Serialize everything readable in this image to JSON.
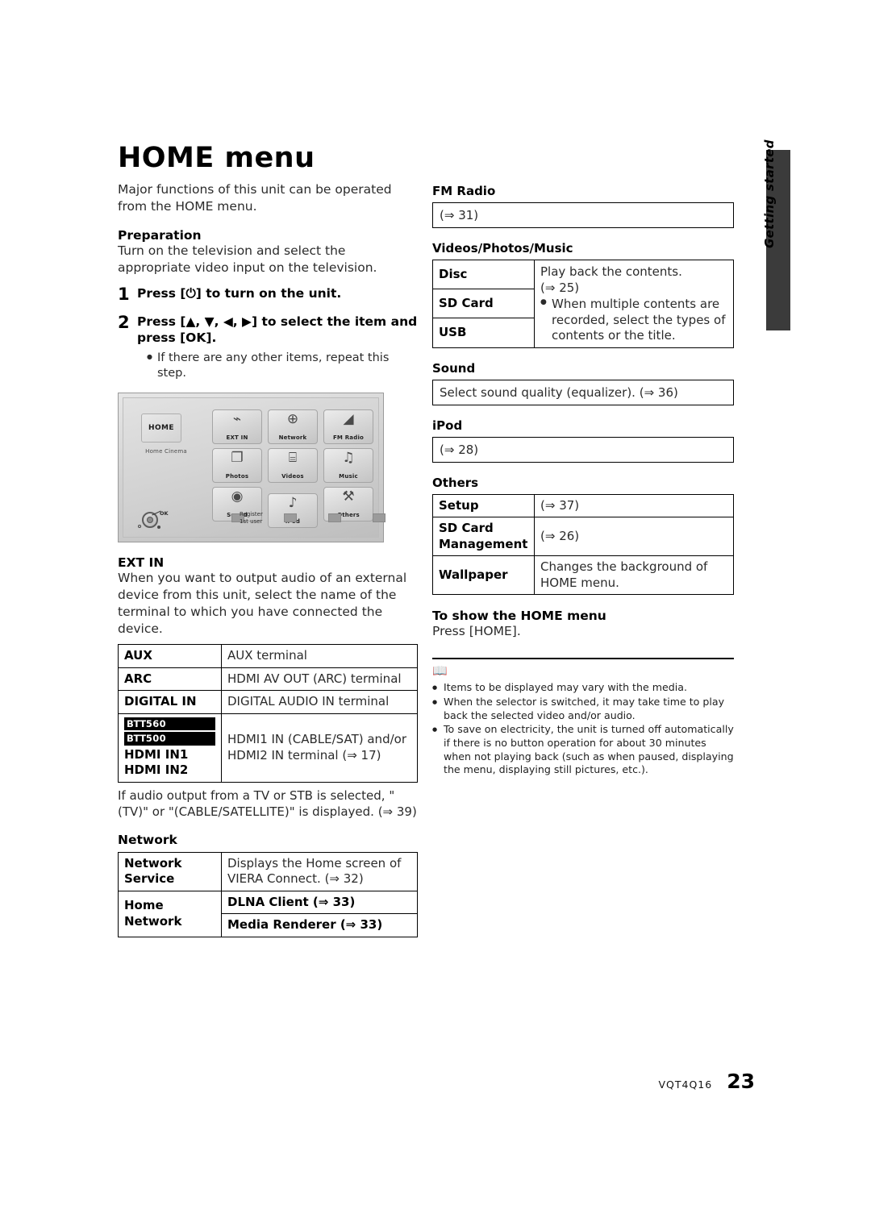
{
  "page": {
    "title": "HOME menu",
    "intro": "Major functions of this unit can be operated from the HOME menu.",
    "preparation_head": "Preparation",
    "preparation_text": "Turn on the television and select the appropriate video input on the television.",
    "footer_code": "VQT4Q16",
    "page_number": "23",
    "side_tab_label": "Getting started",
    "side_tab_color": "#3b3b3b"
  },
  "steps": [
    {
      "num": "1",
      "text": "Press [⏻] to turn on the unit."
    },
    {
      "num": "2",
      "text": "Press [▲, ▼, ◀, ▶] to select the item and press [OK].",
      "sub": "If there are any other items, repeat this step."
    }
  ],
  "screenshot": {
    "home_box_label": "HOME",
    "home_cinema_label": "Home Cinema",
    "tiles": [
      {
        "label": "EXT IN",
        "icon": "plug-icon",
        "glyph": "⌁"
      },
      {
        "label": "Network",
        "icon": "globe-icon",
        "glyph": "⊕"
      },
      {
        "label": "FM Radio",
        "icon": "radio-icon",
        "glyph": "◢"
      },
      {
        "label": "Photos",
        "icon": "photo-icon",
        "glyph": "❐"
      },
      {
        "label": "Videos",
        "icon": "film-icon",
        "glyph": "⌸"
      },
      {
        "label": "Music",
        "icon": "note-icon",
        "glyph": "♫"
      },
      {
        "label": "Sound",
        "icon": "speaker-icon",
        "glyph": "◉"
      },
      {
        "label": "iPod",
        "icon": "ipod-icon",
        "glyph": "♪"
      },
      {
        "label": "Others",
        "icon": "wrench-icon",
        "glyph": "⚒"
      }
    ],
    "ok_label": "OK",
    "register_line1": "Register",
    "register_line2": "1st user"
  },
  "ext_in": {
    "head": "EXT IN",
    "text": "When you want to output audio of an external device from this unit, select the name of the terminal to which you have connected the device.",
    "rows": [
      {
        "key": "AUX",
        "value": "AUX terminal"
      },
      {
        "key": "ARC",
        "value": "HDMI AV OUT (ARC) terminal"
      },
      {
        "key": "DIGITAL IN",
        "value": "DIGITAL AUDIO IN terminal"
      }
    ],
    "hdmi_row": {
      "badges": [
        {
          "prefix": "BTT",
          "suffix": "560"
        },
        {
          "prefix": "BTT",
          "suffix": "500"
        }
      ],
      "key_lines": [
        "HDMI IN1",
        "HDMI IN2"
      ],
      "value": "HDMI1 IN (CABLE/SAT) and/or HDMI2 IN terminal (⇒ 17)"
    },
    "after_table": "If audio output from a TV or STB is selected, \"(TV)\" or \"(CABLE/SATELLITE)\" is displayed. (⇒ 39)"
  },
  "network": {
    "head": "Network",
    "rows": [
      {
        "key": "Network Service",
        "value": "Displays the Home screen of VIERA Connect. (⇒ 32)",
        "bold_value": false
      },
      {
        "key": "Home Network",
        "value": "DLNA Client (⇒ 33)",
        "bold_value": true
      },
      {
        "key": "",
        "value": "Media Renderer (⇒ 33)",
        "bold_value": true
      }
    ]
  },
  "fm_radio": {
    "head": "FM Radio",
    "box": "(⇒ 31)"
  },
  "videos_photos_music": {
    "head": "Videos/Photos/Music",
    "keys": [
      "Disc",
      "SD Card",
      "USB"
    ],
    "value_line1": "Play back the contents.",
    "value_line2": "(⇒ 25)",
    "value_bullet": "When multiple contents are recorded, select the types of contents or the title."
  },
  "sound": {
    "head": "Sound",
    "box": "Select sound quality (equalizer). (⇒ 36)"
  },
  "ipod": {
    "head": "iPod",
    "box": "(⇒ 28)"
  },
  "others": {
    "head": "Others",
    "rows": [
      {
        "key": "Setup",
        "value": "(⇒ 37)"
      },
      {
        "key": "SD Card Management",
        "value": "(⇒ 26)"
      },
      {
        "key": "Wallpaper",
        "value": "Changes the background of HOME menu."
      }
    ]
  },
  "show_home": {
    "head": "To show the HOME menu",
    "text": "Press [HOME]."
  },
  "notes": {
    "icon": "📖",
    "items": [
      "Items to be displayed may vary with the media.",
      "When the selector is switched, it may take time to play back the selected video and/or audio.",
      "To save on electricity, the unit is turned off automatically if there is no button operation for about 30 minutes when not playing back (such as when paused, displaying the menu, displaying still pictures, etc.)."
    ]
  }
}
